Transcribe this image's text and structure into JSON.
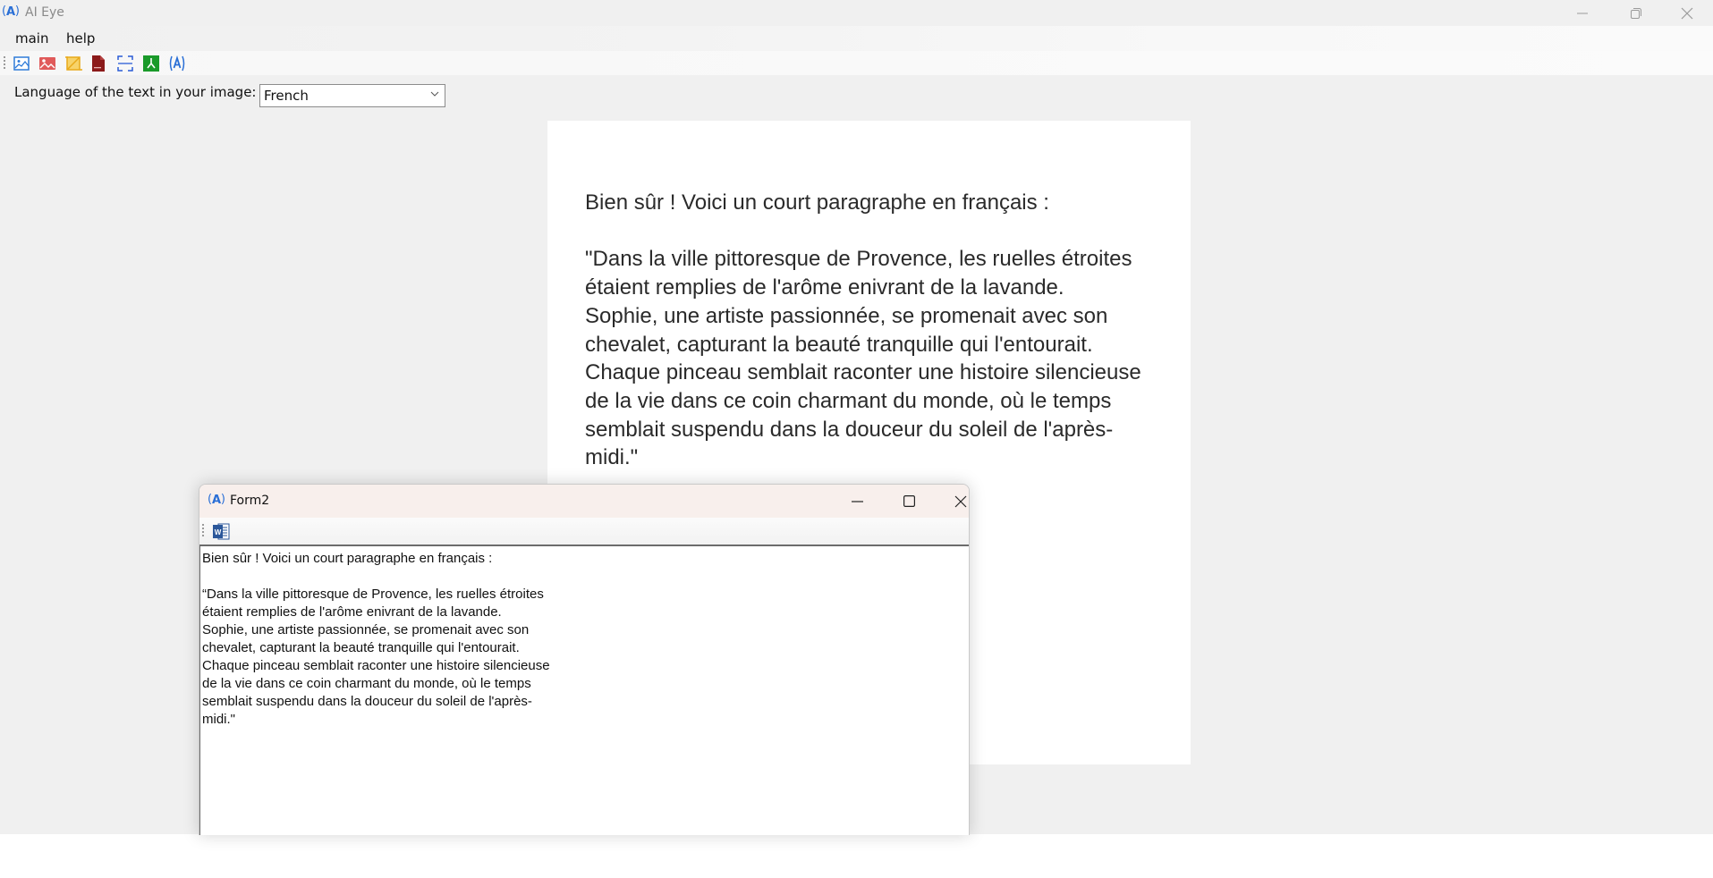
{
  "app": {
    "title": "AI Eye",
    "window_controls": {
      "minimize": "—",
      "restore": "❐",
      "close": "✕"
    }
  },
  "menu": {
    "items": [
      "main",
      "help"
    ]
  },
  "toolbar": {
    "icons": [
      {
        "name": "open-image-icon",
        "color": "#2f7bd9"
      },
      {
        "name": "image-red-icon",
        "color": "#e05252"
      },
      {
        "name": "crop-icon",
        "color": "#f0b429"
      },
      {
        "name": "pdf-file-icon",
        "color": "#8b1a1a"
      },
      {
        "name": "scan-frame-icon",
        "color": "#2a5bd6"
      },
      {
        "name": "acrobat-icon",
        "color": "#1a9a2a"
      },
      {
        "name": "ocr-logo-icon",
        "color": "#2a6fd6"
      }
    ]
  },
  "language": {
    "label": "Language of the text in your image:",
    "selected": "French"
  },
  "image_panel": {
    "text": "Bien sûr ! Voici un court paragraphe en français :\n\n\"Dans la ville pittoresque de Provence, les ruelles étroites\nétaient remplies de l'arôme enivrant de la lavande.\nSophie, une artiste passionnée, se promenait avec son\nchevalet, capturant la beauté tranquille qui l'entourait.\nChaque pinceau semblait raconter une histoire silencieuse\nde la vie dans ce coin charmant du monde, où le temps\nsemblait suspendu dans la douceur du soleil de l'après-\nmidi.\""
  },
  "form2": {
    "title": "Form2",
    "window_controls": {
      "minimize": "—",
      "maximize": "□",
      "close": "✕"
    },
    "toolbar_icon": "word-export-icon",
    "text": "Bien sûr ! Voici un court paragraphe en français :\n\n“Dans la ville pittoresque de Provence, les ruelles étroites\nétaient remplies de l'arôme enivrant de la lavande.\nSophie, une artiste passionnée, se promenait avec son\nchevalet, capturant la beauté tranquille qui l'entourait.\nChaque pinceau semblait raconter une histoire silencieuse\nde la vie dans ce coin charmant du monde, où le temps\nsemblait suspendu dans la douceur du soleil de l'après-\nmidi.\""
  }
}
